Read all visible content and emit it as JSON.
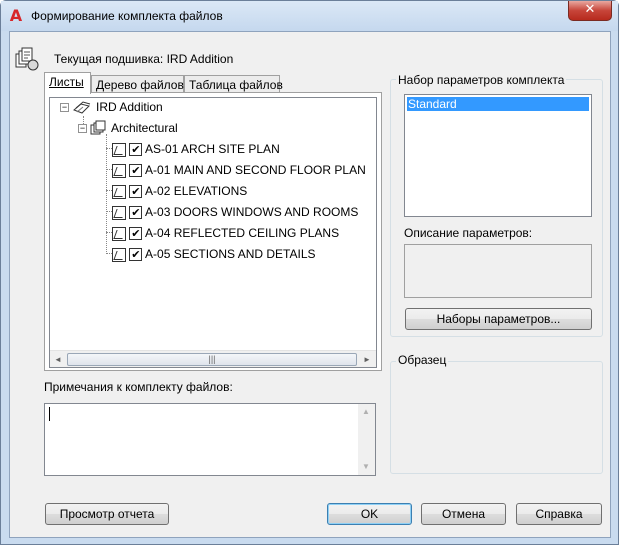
{
  "window": {
    "title": "Формирование комплекта файлов",
    "close_glyph": "✕"
  },
  "current_sheetset": "Текущая подшивка: IRD Addition",
  "tabs": [
    {
      "label": "Листы",
      "active": true
    },
    {
      "label": "Дерево файлов",
      "active": false
    },
    {
      "label": "Таблица файлов",
      "active": false
    }
  ],
  "tree": {
    "root": {
      "label": "IRD Addition",
      "expander": "−",
      "icon": "sheetset-icon"
    },
    "subset": {
      "label": "Architectural",
      "expander": "−",
      "icon": "subset-icon"
    },
    "sheets": [
      {
        "label": "AS-01 ARCH SITE PLAN",
        "checked": true
      },
      {
        "label": "A-01 MAIN AND SECOND FLOOR PLAN",
        "checked": true
      },
      {
        "label": "A-02 ELEVATIONS",
        "checked": true
      },
      {
        "label": "A-03 DOORS WINDOWS AND ROOMS",
        "checked": true
      },
      {
        "label": "A-04 REFLECTED CEILING PLANS",
        "checked": true
      },
      {
        "label": "A-05 SECTIONS AND DETAILS",
        "checked": true
      }
    ],
    "check_glyph": "✔"
  },
  "scroll": {
    "left_arrow": "◄",
    "right_arrow": "►",
    "up_arrow": "▲",
    "down_arrow": "▼",
    "grip": "|||"
  },
  "notes": {
    "label": "Примечания к комплекту файлов:",
    "value": ""
  },
  "transmittal": {
    "group_label": "Набор параметров комплекта",
    "options": [
      "Standard"
    ],
    "selected": "Standard",
    "description_label": "Описание параметров:",
    "setups_button": "Наборы параметров..."
  },
  "preview": {
    "group_label": "Образец"
  },
  "buttons": {
    "view_report": "Просмотр отчета",
    "ok": "OK",
    "cancel": "Отмена",
    "help": "Справка"
  },
  "colors": {
    "selection": "#3399ff",
    "title_bar": "#c9dbef",
    "close_button": "#c7453a"
  }
}
